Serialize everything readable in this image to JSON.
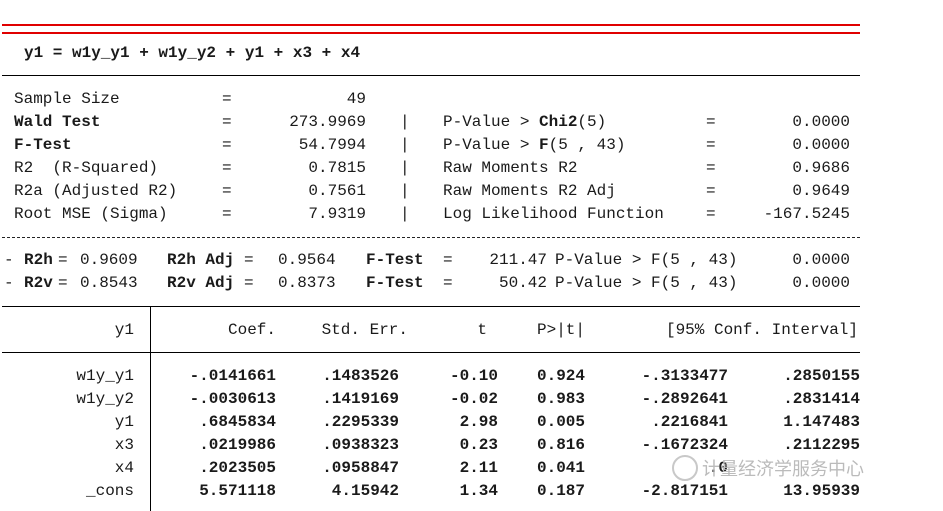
{
  "model": {
    "equation": "y1 = w1y_y1 + w1y_y2 + y1 + x3 + x4"
  },
  "stats_left": [
    {
      "label": "Sample Size",
      "bold": false,
      "eq": "=",
      "value": "49"
    },
    {
      "label": "Wald Test",
      "bold": true,
      "eq": "=",
      "value": "273.9969"
    },
    {
      "label": "F-Test",
      "bold": true,
      "eq": "=",
      "value": "54.7994"
    },
    {
      "label": "R2  (R-Squared)",
      "bold": false,
      "eq": "=",
      "value": "0.7815"
    },
    {
      "label": "R2a (Adjusted R2)",
      "bold": false,
      "eq": "=",
      "value": "0.7561"
    },
    {
      "label": "Root MSE (Sigma)",
      "bold": false,
      "eq": "=",
      "value": "7.9319"
    }
  ],
  "stats_right": [
    {
      "sep": "|",
      "label_pre": "P-Value > ",
      "label_bold": "Chi2",
      "label_post": "(5)",
      "eq": "=",
      "value": "0.0000"
    },
    {
      "sep": "|",
      "label_pre": "P-Value > ",
      "label_bold": "F",
      "label_post": "(5 , 43)",
      "eq": "=",
      "value": "0.0000"
    },
    {
      "sep": "|",
      "label_pre": "Raw Moments R2",
      "label_bold": "",
      "label_post": "",
      "eq": "=",
      "value": "0.9686"
    },
    {
      "sep": "|",
      "label_pre": "Raw Moments R2 Adj",
      "label_bold": "",
      "label_post": "",
      "eq": "=",
      "value": "0.9649"
    },
    {
      "sep": "|",
      "label_pre": "Log Likelihood Function",
      "label_bold": "",
      "label_post": "",
      "eq": "=",
      "value": "-167.5245"
    }
  ],
  "decomp": [
    {
      "dash": "-",
      "k1": "R2h",
      "v1": "0.9609",
      "k2": "R2h Adj",
      "v2": "0.9564",
      "k3": "F-Test",
      "v3": "211.47",
      "pv": "P-Value > F(5 , 43)",
      "p": "0.0000"
    },
    {
      "dash": "-",
      "k1": "R2v",
      "v1": "0.8543",
      "k2": "R2v Adj",
      "v2": "0.8373",
      "k3": "F-Test",
      "v3": "50.42",
      "pv": "P-Value > F(5 , 43)",
      "p": "0.0000"
    }
  ],
  "table": {
    "headers": {
      "var": "y1",
      "coef": "Coef.",
      "se": "Std. Err.",
      "t": "t",
      "p": "P>|t|",
      "ci": "[95% Conf. Interval]"
    },
    "rows": [
      {
        "var": "w1y_y1",
        "coef": "-.0141661",
        "se": ".1483526",
        "t": "-0.10",
        "p": "0.924",
        "lo": "-.3133477",
        "hi": ".2850155"
      },
      {
        "var": "w1y_y2",
        "coef": "-.0030613",
        "se": ".1419169",
        "t": "-0.02",
        "p": "0.983",
        "lo": "-.2892641",
        "hi": ".2831414"
      },
      {
        "var": "y1",
        "coef": ".6845834",
        "se": ".2295339",
        "t": "2.98",
        "p": "0.005",
        "lo": ".2216841",
        "hi": "1.147483"
      },
      {
        "var": "x3",
        "coef": ".0219986",
        "se": ".0938323",
        "t": "0.23",
        "p": "0.816",
        "lo": "-.1672324",
        "hi": ".2112295"
      },
      {
        "var": "x4",
        "coef": ".2023505",
        "se": ".0958847",
        "t": "2.11",
        "p": "0.041",
        "lo": ".0",
        "hi": ""
      },
      {
        "var": "_cons",
        "coef": "5.571118",
        "se": "4.15942",
        "t": "1.34",
        "p": "0.187",
        "lo": "-2.817151",
        "hi": "13.95939"
      }
    ]
  },
  "watermark": {
    "text": "计量经济学服务中心"
  }
}
